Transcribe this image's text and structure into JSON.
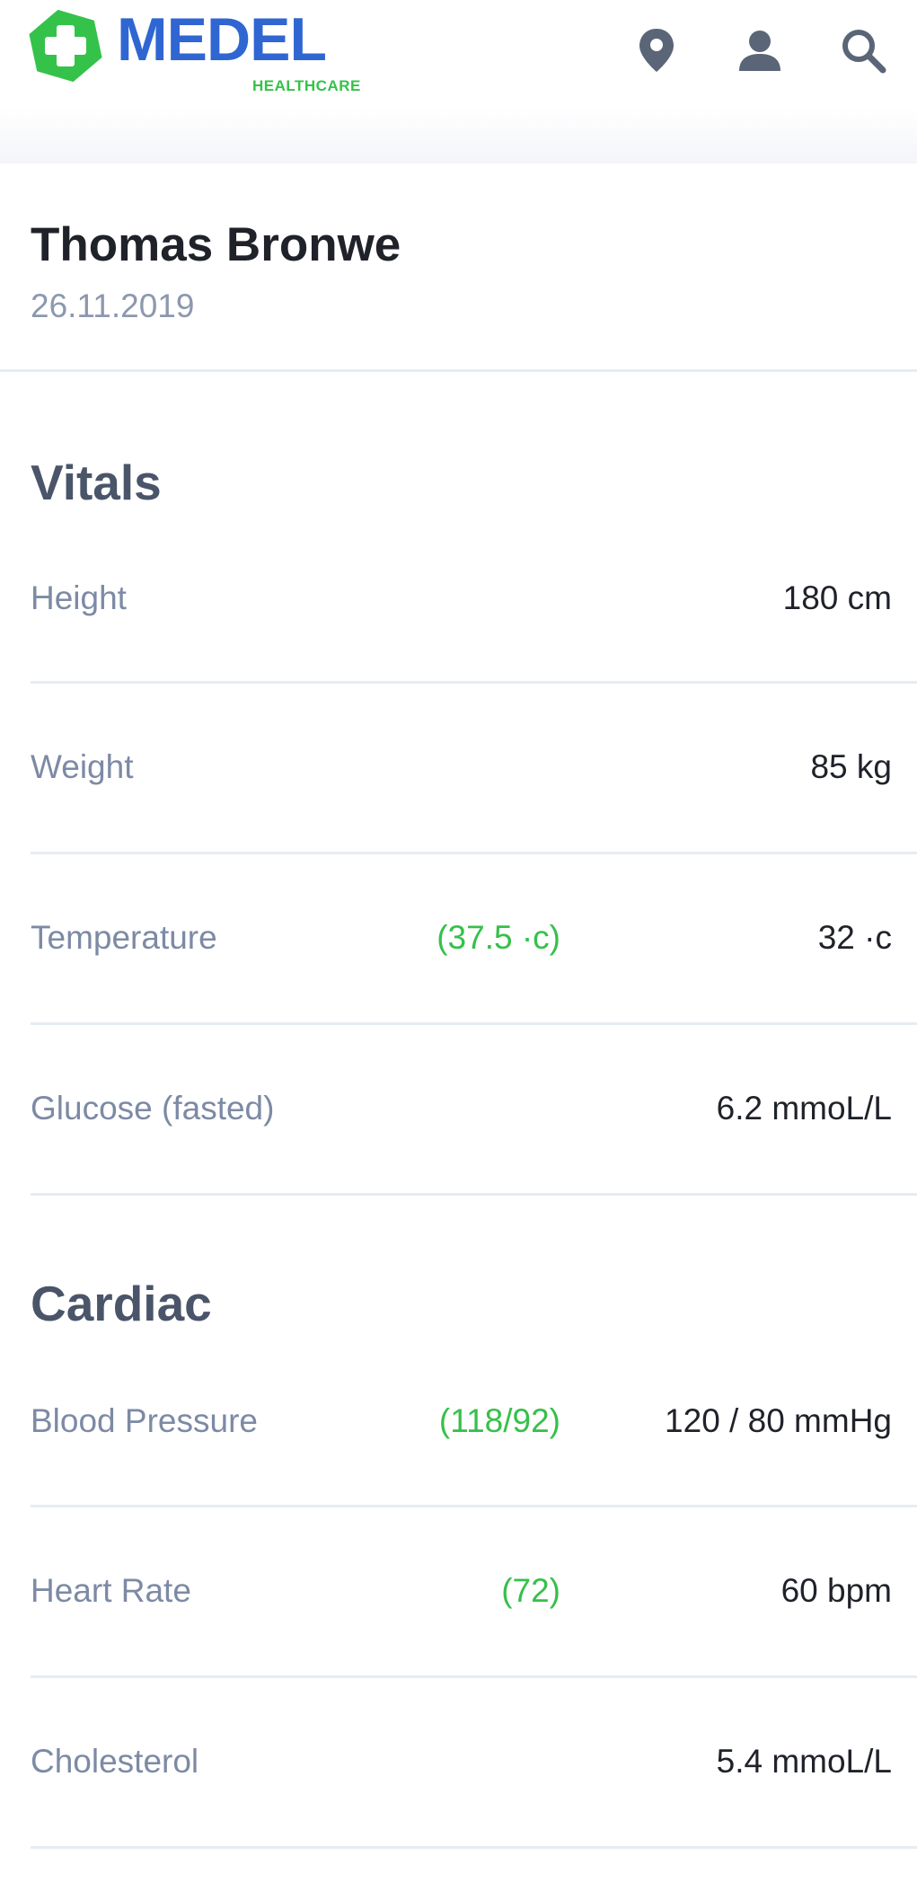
{
  "brand": {
    "name": "MEDEL",
    "tagline": "HEALTHCARE",
    "colors": {
      "primary": "#2f66d2",
      "green": "#35c24a"
    }
  },
  "header": {
    "icons": [
      "location-pin-icon",
      "user-icon",
      "search-icon"
    ]
  },
  "patient": {
    "name": "Thomas Bronwe",
    "date": "26.11.2019"
  },
  "sections": {
    "vitals": {
      "title": "Vitals",
      "rows": [
        {
          "label": "Height",
          "reference": "",
          "value": "180 cm"
        },
        {
          "label": "Weight",
          "reference": "",
          "value": "85 kg"
        },
        {
          "label": "Temperature",
          "reference": "(37.5 ·c)",
          "value": "32 ·c"
        },
        {
          "label": "Glucose (fasted)",
          "reference": "",
          "value": "6.2 mmoL/L"
        }
      ]
    },
    "cardiac": {
      "title": "Cardiac",
      "rows": [
        {
          "label": "Blood Pressure",
          "reference": "(118/92)",
          "value": "120 / 80 mmHg"
        },
        {
          "label": "Heart Rate",
          "reference": "(72)",
          "value": "60 bpm"
        },
        {
          "label": "Cholesterol",
          "reference": "",
          "value": "5.4 mmoL/L"
        }
      ]
    }
  }
}
